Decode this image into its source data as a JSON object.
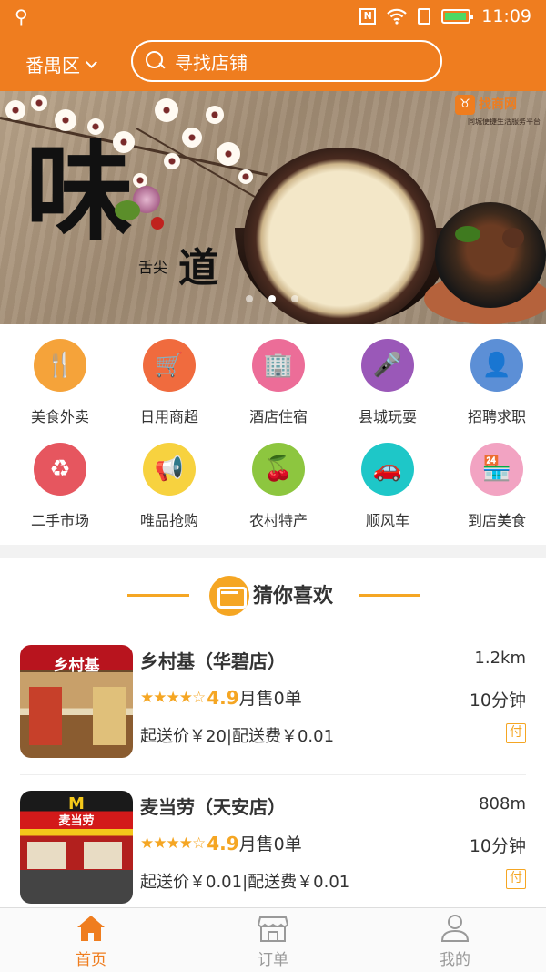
{
  "status_bar": {
    "time": "11:09"
  },
  "header": {
    "district": "番禺区",
    "search_placeholder": "寻找店铺"
  },
  "banner": {
    "big_char": "味",
    "text_small": "舌尖",
    "text_large": "道",
    "brand_name": "找商网",
    "brand_slogan": "同城便捷生活服务平台"
  },
  "categories": [
    {
      "label": "美食外卖",
      "icon": "fork-knife-icon",
      "color": "#f5a33a",
      "glyph": "🍴"
    },
    {
      "label": "日用商超",
      "icon": "phone-cart-icon",
      "color": "#f06b3e",
      "glyph": "🛒"
    },
    {
      "label": "酒店住宿",
      "icon": "building-icon",
      "color": "#ec6d98",
      "glyph": "🏢"
    },
    {
      "label": "县城玩耍",
      "icon": "microphone-icon",
      "color": "#9a58b8",
      "glyph": "🎤"
    },
    {
      "label": "招聘求职",
      "icon": "person-icon",
      "color": "#5c8fd6",
      "glyph": "👤"
    },
    {
      "label": "二手市场",
      "icon": "heart-recycle-icon",
      "color": "#e6565f",
      "glyph": "♻"
    },
    {
      "label": "唯品抢购",
      "icon": "megaphone-icon",
      "color": "#f7d23f",
      "glyph": "📢"
    },
    {
      "label": "农村特产",
      "icon": "cherry-icon",
      "color": "#8dc63f",
      "glyph": "🍒"
    },
    {
      "label": "顺风车",
      "icon": "car-icon",
      "color": "#1ec7c8",
      "glyph": "🚗"
    },
    {
      "label": "到店美食",
      "icon": "storefront-icon",
      "color": "#f2a3c2",
      "glyph": "🏪"
    }
  ],
  "recommend": {
    "title": "猜你喜欢",
    "stores": [
      {
        "name": "乡村基（华碧店）",
        "distance": "1.2km",
        "rating": 4.9,
        "rating_text": "4.9",
        "sales": "月售0单",
        "time": "10分钟",
        "fee": "起送价￥20|配送费￥0.01",
        "pay": "付",
        "sign": "乡村基"
      },
      {
        "name": "麦当劳（天安店）",
        "distance": "808m",
        "rating": 4.9,
        "rating_text": "4.9",
        "sales": "月售0单",
        "time": "10分钟",
        "fee": "起送价￥0.01|配送费￥0.01",
        "pay": "付",
        "sign": "麦当劳"
      }
    ]
  },
  "bottom_nav": [
    {
      "label": "首页",
      "icon": "home-icon",
      "active": true
    },
    {
      "label": "订单",
      "icon": "store-order-icon",
      "active": false
    },
    {
      "label": "我的",
      "icon": "user-icon",
      "active": false
    }
  ],
  "colors": {
    "primary": "#ef7d1f",
    "accent": "#f5a623"
  }
}
